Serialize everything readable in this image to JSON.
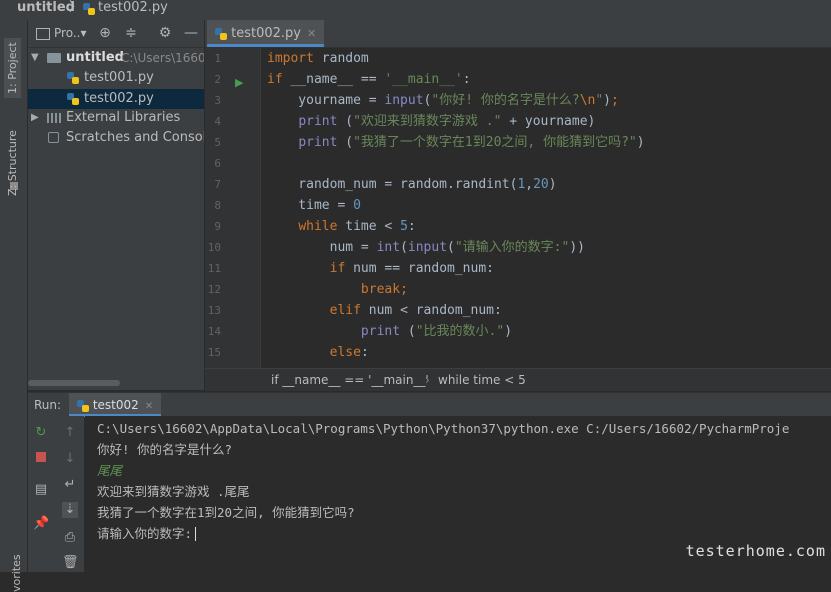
{
  "navbar": {
    "project": "untitled",
    "separator": "〉",
    "file": "test002.py"
  },
  "toolstrip": {
    "project_tab": "1: Project",
    "structure_tab": "Z: Structure",
    "favorites_tab": "vorites"
  },
  "project_panel": {
    "title": "Pro..▾",
    "tree": [
      {
        "label": "untitled",
        "path": "C:\\Users\\1660"
      },
      {
        "label": "test001.py"
      },
      {
        "label": "test002.py"
      },
      {
        "label": "External Libraries"
      },
      {
        "label": "Scratches and Consoles"
      }
    ]
  },
  "editor": {
    "tab_label": "test002.py",
    "line_numbers": [
      "1",
      "2",
      "3",
      "4",
      "5",
      "6",
      "7",
      "8",
      "9",
      "10",
      "11",
      "12",
      "13",
      "14",
      "15"
    ],
    "breadcrumb": {
      "first": "if __name__ == '__main__'",
      "sep": "›",
      "second": "while time < 5"
    }
  },
  "run": {
    "label": "Run:",
    "tab": "test002",
    "output": [
      "C:\\Users\\16602\\AppData\\Local\\Programs\\Python\\Python37\\python.exe C:/Users/16602/PycharmProje",
      "你好! 你的名字是什么?",
      "尾尾",
      "欢迎来到猜数字游戏 .尾尾",
      "我猜了一个数字在1到20之间, 你能猜到它吗?",
      "请输入你的数字:"
    ]
  },
  "watermark": "testerhome.com"
}
